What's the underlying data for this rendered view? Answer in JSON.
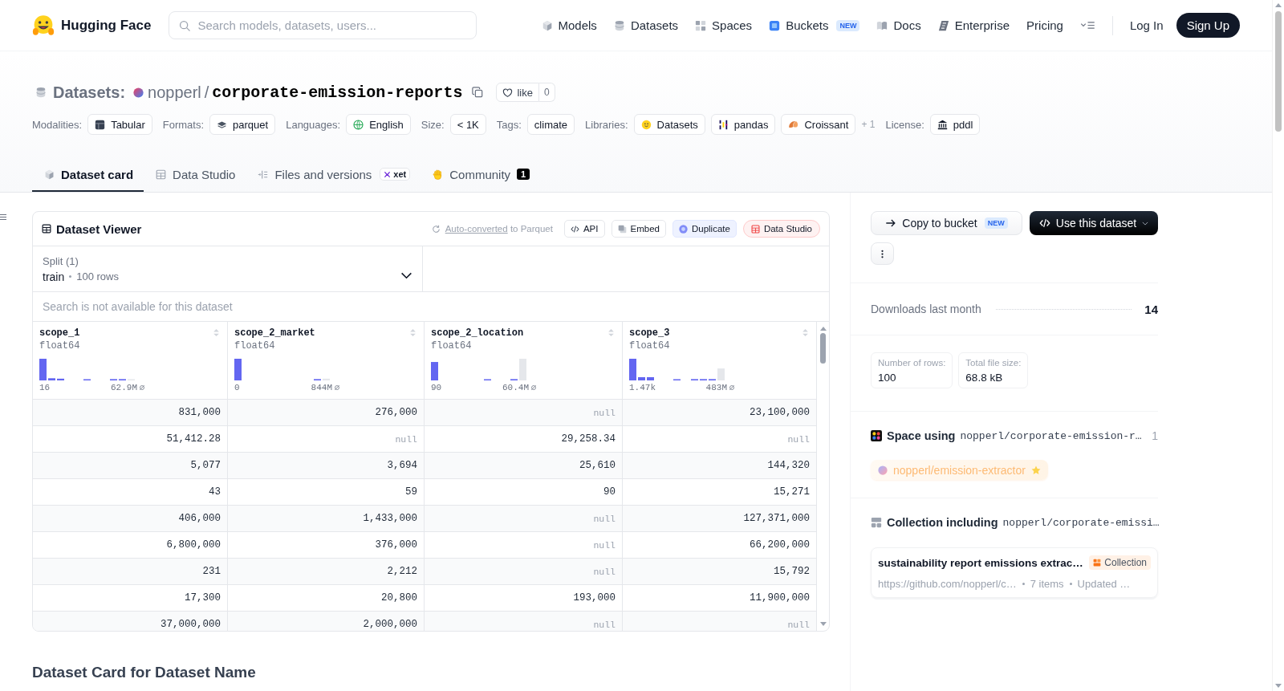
{
  "nav": {
    "brand": "Hugging Face",
    "search": {
      "placeholder": "Search models, datasets, users..."
    },
    "items": [
      {
        "label": "Models"
      },
      {
        "label": "Datasets"
      },
      {
        "label": "Spaces"
      },
      {
        "label": "Buckets",
        "badge": "NEW"
      },
      {
        "label": "Docs"
      },
      {
        "label": "Enterprise"
      },
      {
        "label": "Pricing"
      }
    ],
    "login": "Log In",
    "signup": "Sign Up"
  },
  "header": {
    "section": "Datasets:",
    "owner": "nopperl",
    "separator": "/",
    "name": "corporate-emission-reports",
    "like": {
      "label": "like",
      "count": "0"
    }
  },
  "metadata": [
    {
      "label": "Modalities:",
      "chips": [
        "Tabular"
      ]
    },
    {
      "label": "Formats:",
      "chips": [
        "parquet"
      ]
    },
    {
      "label": "Languages:",
      "chips": [
        "English"
      ]
    },
    {
      "label": "Size:",
      "chips": [
        "< 1K"
      ]
    },
    {
      "label": "Tags:",
      "chips": [
        "climate"
      ]
    },
    {
      "label": "Libraries:",
      "chips": [
        "Datasets",
        "pandas",
        "Croissant"
      ],
      "more": "+ 1"
    },
    {
      "label": "License:",
      "chips": [
        "pddl"
      ]
    }
  ],
  "tabs": [
    {
      "label": "Dataset card",
      "selected": true
    },
    {
      "label": "Data Studio",
      "selected": false
    },
    {
      "label": "Files and versions",
      "selected": false,
      "badge": "xet"
    },
    {
      "label": "Community",
      "selected": false,
      "count": "1"
    }
  ],
  "viewer": {
    "title": "Dataset Viewer",
    "conversion": {
      "link": "Auto-converted",
      "text": "to Parquet"
    },
    "actions": [
      {
        "label": "API",
        "kind": "plain"
      },
      {
        "label": "Embed",
        "kind": "plain"
      },
      {
        "label": "Duplicate",
        "kind": "accent"
      },
      {
        "label": "Data Studio",
        "kind": "danger"
      }
    ],
    "split": {
      "label": "Split (1)",
      "value": "train",
      "rows": "100 rows"
    },
    "search": {
      "placeholder": "Search is not available for this dataset"
    },
    "columns": [
      {
        "name": "scope_1",
        "dtype": "float64",
        "min": "16",
        "max": "62.9M"
      },
      {
        "name": "scope_2_market",
        "dtype": "float64",
        "min": "0",
        "max": "844M"
      },
      {
        "name": "scope_2_location",
        "dtype": "float64",
        "min": "90",
        "max": "60.4M"
      },
      {
        "name": "scope_3",
        "dtype": "float64",
        "min": "1.47k",
        "max": "483M"
      }
    ],
    "rows": [
      [
        {
          "text": "831,000",
          "missing": false
        },
        {
          "text": "276,000",
          "missing": false
        },
        {
          "text": "null",
          "missing": true
        },
        {
          "text": "23,100,000",
          "missing": false
        }
      ],
      [
        {
          "text": "51,412.28",
          "missing": false
        },
        {
          "text": "null",
          "missing": true
        },
        {
          "text": "29,258.34",
          "missing": false
        },
        {
          "text": "null",
          "missing": true
        }
      ],
      [
        {
          "text": "5,077",
          "missing": false
        },
        {
          "text": "3,694",
          "missing": false
        },
        {
          "text": "25,610",
          "missing": false
        },
        {
          "text": "144,320",
          "missing": false
        }
      ],
      [
        {
          "text": "43",
          "missing": false
        },
        {
          "text": "59",
          "missing": false
        },
        {
          "text": "90",
          "missing": false
        },
        {
          "text": "15,271",
          "missing": false
        }
      ],
      [
        {
          "text": "406,000",
          "missing": false
        },
        {
          "text": "1,433,000",
          "missing": false
        },
        {
          "text": "null",
          "missing": true
        },
        {
          "text": "127,371,000",
          "missing": false
        }
      ],
      [
        {
          "text": "6,800,000",
          "missing": false
        },
        {
          "text": "376,000",
          "missing": false
        },
        {
          "text": "null",
          "missing": true
        },
        {
          "text": "66,200,000",
          "missing": false
        }
      ],
      [
        {
          "text": "231",
          "missing": false
        },
        {
          "text": "2,212",
          "missing": false
        },
        {
          "text": "null",
          "missing": true
        },
        {
          "text": "15,792",
          "missing": false
        }
      ],
      [
        {
          "text": "17,300",
          "missing": false
        },
        {
          "text": "20,800",
          "missing": false
        },
        {
          "text": "193,000",
          "missing": false
        },
        {
          "text": "11,900,000",
          "missing": false
        }
      ],
      [
        {
          "text": "37,000,000",
          "missing": false
        },
        {
          "text": "2,000,000",
          "missing": false
        },
        {
          "text": "null",
          "missing": true
        },
        {
          "text": "null",
          "missing": true
        }
      ]
    ]
  },
  "sidebar": {
    "copy_button": {
      "label": "Copy to bucket",
      "badge": "NEW"
    },
    "use_button": {
      "label": "Use this dataset"
    },
    "downloads": {
      "label": "Downloads last month",
      "value": "14"
    },
    "stats": [
      {
        "label": "Number of rows:",
        "value": "100"
      },
      {
        "label": "Total file size:",
        "value": "68.8 kB"
      }
    ],
    "spaces": {
      "title": "Space using",
      "repo": "nopperl/corporate-emission-r…",
      "count": "1",
      "items": [
        {
          "name": "nopperl/emission-extractor"
        }
      ]
    },
    "collections": {
      "title": "Collection including",
      "repo": "nopperl/corporate-emissi…",
      "items": [
        {
          "title": "sustainability report emissions extrac…",
          "badge": "Collection",
          "url": "https://github.com/nopperl/c…",
          "count": "7 items",
          "updated": "Updated …"
        }
      ]
    }
  },
  "card_heading": "Dataset Card for Dataset Name"
}
